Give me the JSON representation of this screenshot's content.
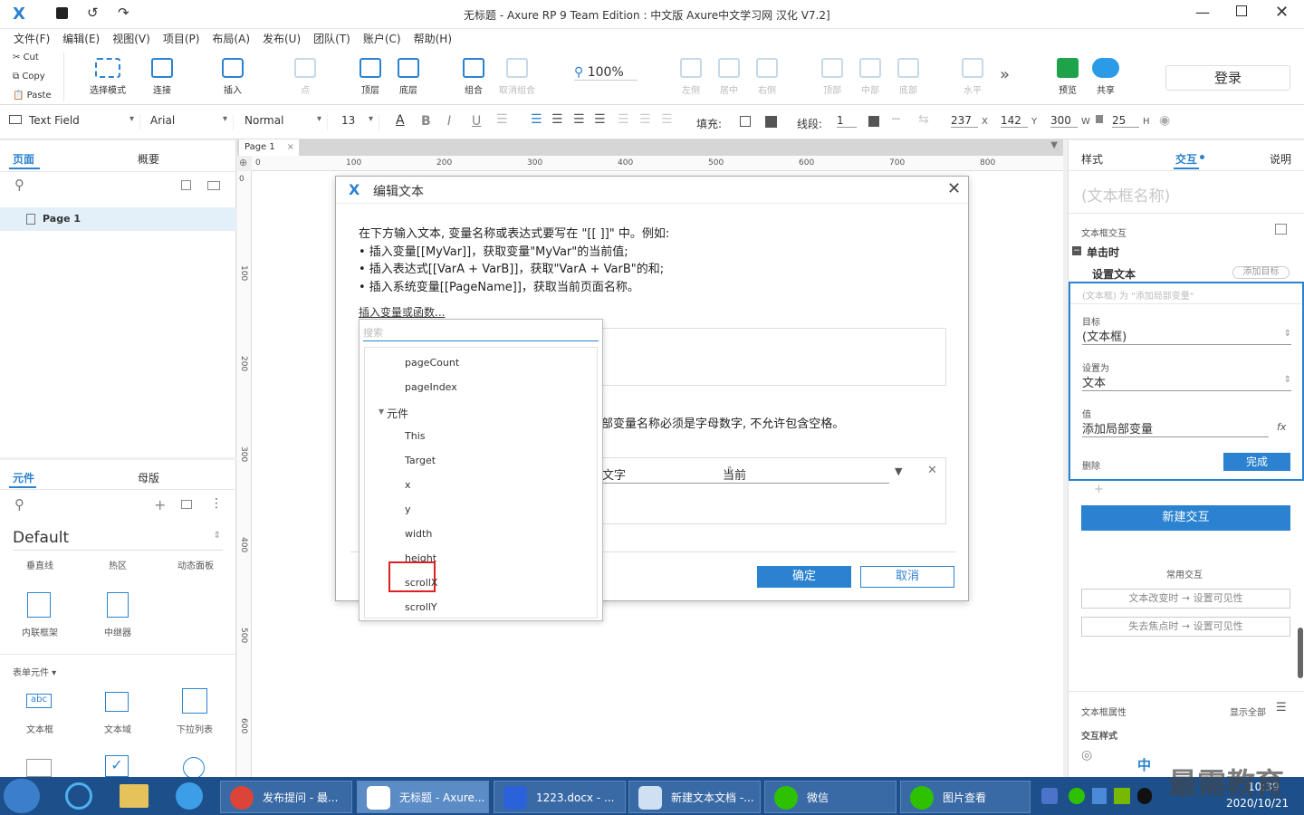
{
  "window": {
    "title": "无标题 - Axure RP 9 Team Edition : 中文版   Axure中文学习网 汉化 V7.2]"
  },
  "menu": [
    "文件(F)",
    "编辑(E)",
    "视图(V)",
    "项目(P)",
    "布局(A)",
    "发布(U)",
    "团队(T)",
    "账户(C)",
    "帮助(H)"
  ],
  "clipboard": {
    "cut": "Cut",
    "copy": "Copy",
    "paste": "Paste"
  },
  "toolbar": {
    "select": "选择模式",
    "connect": "连接",
    "insert": "插入",
    "point": "点",
    "top": "顶层",
    "bottom": "底层",
    "group": "组合",
    "ungroup": "取消组合",
    "zoom": "100%",
    "left": "左侧",
    "center": "居中",
    "right": "右侧",
    "vtop": "顶部",
    "middle": "中部",
    "vbottom": "底部",
    "horizontal": "水平",
    "preview": "预览",
    "share": "共享",
    "login": "登录"
  },
  "format": {
    "widget": "Text Field",
    "font": "Arial",
    "style": "Normal",
    "size": "13",
    "fill_label": "填充:",
    "stroke_label": "线段:",
    "stroke_value": "1",
    "x": "237",
    "x_label": "X",
    "y": "142",
    "y_label": "Y",
    "w": "300",
    "w_label": "W",
    "h": "25",
    "h_label": "H"
  },
  "pages_panel": {
    "tab_pages": "页面",
    "tab_outline": "概要",
    "page1": "Page 1"
  },
  "library_panel": {
    "tab_widgets": "元件",
    "tab_masters": "母版",
    "library": "Default",
    "w1": "垂直线",
    "w2": "热区",
    "w3": "动态面板",
    "w4": "内联框架",
    "w5": "中继器",
    "section": "表单元件 ▾",
    "w6": "文本框",
    "w7": "文本域",
    "w8": "下拉列表"
  },
  "canvas": {
    "tab": "Page 1",
    "ruler": [
      "0",
      "100",
      "200",
      "300",
      "400",
      "500",
      "600",
      "700",
      "800"
    ],
    "vruler": [
      "0",
      "100",
      "200",
      "300",
      "400",
      "500",
      "600"
    ]
  },
  "dialog": {
    "title": "编辑文本",
    "intro": "在下方输入文本, 变量名称或表达式要写在 \"[[ ]]\" 中。例如:",
    "line1": "• 插入变量[[MyVar]]，获取变量\"MyVar\"的当前值;",
    "line2": "• 插入表达式[[VarA + VarB]]，获取\"VarA + VarB\"的和;",
    "line3": "• 插入系统变量[[PageName]]，获取当前页面名称。",
    "insert_link": "插入变量或函数...",
    "note": "部变量名称必须是字母数字, 不允许包含空格。",
    "col_type": "文字",
    "col_value": "当前",
    "ok": "确定",
    "cancel": "取消"
  },
  "dropdown": {
    "search_placeholder": "搜索",
    "items": [
      "pageCount",
      "pageIndex",
      "元件",
      "This",
      "Target",
      "x",
      "y",
      "width",
      "height",
      "scrollX",
      "scrollY"
    ]
  },
  "right_panel": {
    "tab_style": "样式",
    "tab_interaction": "交互",
    "tab_notes": "说明",
    "widget_name": "(文本框名称)",
    "section": "文本框交互",
    "event": "单击时",
    "action": "设置文本",
    "add_target": "添加目标",
    "summary": "(文本框) 为 \"添加局部变量\"",
    "target_label": "目标",
    "target_value": "(文本框)",
    "setto_label": "设置为",
    "setto_value": "文本",
    "value_label": "值",
    "value_value": "添加局部变量",
    "fx": "fx",
    "delete": "删除",
    "done": "完成",
    "plus": "+",
    "new_interaction": "新建交互",
    "common": "常用交互",
    "common1": "文本改变时 → 设置可见性",
    "common2": "失去焦点时 → 设置可见性",
    "props": "文本框属性",
    "show_all": "显示全部",
    "int_style": "交互样式"
  },
  "taskbar": {
    "t1": "发布提问 - 最...",
    "t2": "无标题 - Axure...",
    "t3": "1223.docx - ...",
    "t4": "新建文本文档 -...",
    "t5": "微信",
    "t6": "图片查看",
    "ime": "中",
    "time": "10:39",
    "date": "2020/10/21",
    "watermark": "最需教育"
  },
  "colors": {
    "accent": "#2b82d0",
    "taskbar": "#1d4f8a",
    "highlight": "#e02020"
  }
}
